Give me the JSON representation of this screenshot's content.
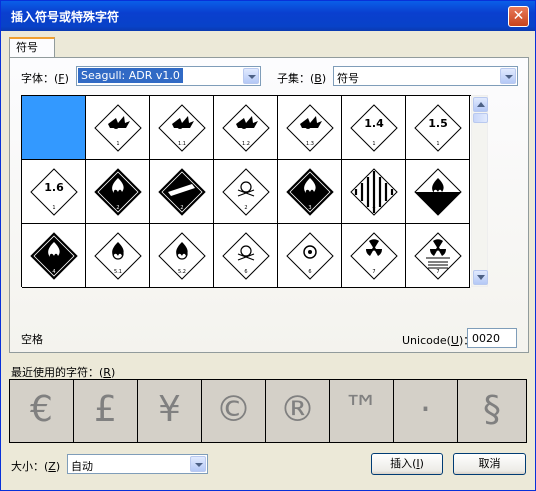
{
  "window": {
    "title": "插入符号或特殊字符",
    "close_glyph": "✕"
  },
  "tab": {
    "label": "符号"
  },
  "font": {
    "label_pre": "字体：(",
    "label_key": "F",
    "label_post": ")",
    "value": "Seagull: ADR v1.0"
  },
  "subset": {
    "label_pre": "子集：(",
    "label_key": "B",
    "label_post": ")",
    "value": "符号"
  },
  "symbols": [
    {
      "icon": "blank",
      "num": ""
    },
    {
      "icon": "explosive",
      "num": "1"
    },
    {
      "icon": "explosive",
      "num": "1.1"
    },
    {
      "icon": "explosive",
      "num": "1.2"
    },
    {
      "icon": "explosive",
      "num": "1.3"
    },
    {
      "icon": "div-number",
      "label": "1.4",
      "num": "1"
    },
    {
      "icon": "div-number",
      "label": "1.5",
      "num": "1"
    },
    {
      "icon": "div-number",
      "label": "1.6",
      "num": "1"
    },
    {
      "icon": "flame-black",
      "num": "2"
    },
    {
      "icon": "gas-cylinder-black",
      "num": "2"
    },
    {
      "icon": "skull",
      "num": "2"
    },
    {
      "icon": "flame-black",
      "num": "3"
    },
    {
      "icon": "flammable-solid-stripes",
      "num": "4"
    },
    {
      "icon": "flame-half-black",
      "num": "4"
    },
    {
      "icon": "flame-black",
      "num": "4"
    },
    {
      "icon": "flame-over-circle",
      "num": "5.1"
    },
    {
      "icon": "flame-over-circle",
      "num": "5.2"
    },
    {
      "icon": "skull",
      "num": "6"
    },
    {
      "icon": "biohazard",
      "num": "6"
    },
    {
      "icon": "radioactive",
      "num": "7"
    },
    {
      "icon": "radioactive-stripes",
      "num": "7"
    }
  ],
  "selected_char_name": "空格",
  "unicode": {
    "label_pre": "Unicode(",
    "label_key": "U",
    "label_post": ")：",
    "value": "0020"
  },
  "recent": {
    "label_pre": "最近使用的字符：(",
    "label_key": "R",
    "label_post": ")",
    "chars": [
      "€",
      "£",
      "¥",
      "©",
      "®",
      "™",
      "·",
      "§"
    ]
  },
  "size": {
    "label_pre": "大小：(",
    "label_key": "Z",
    "label_post": ")",
    "value": "自动"
  },
  "buttons": {
    "insert_pre": "插入(",
    "insert_key": "I",
    "insert_post": ")",
    "cancel": "取消"
  },
  "colors": {
    "selection": "#3399ff",
    "title_bar": "#0a46d8",
    "dialog_bg": "#ece9d8"
  }
}
